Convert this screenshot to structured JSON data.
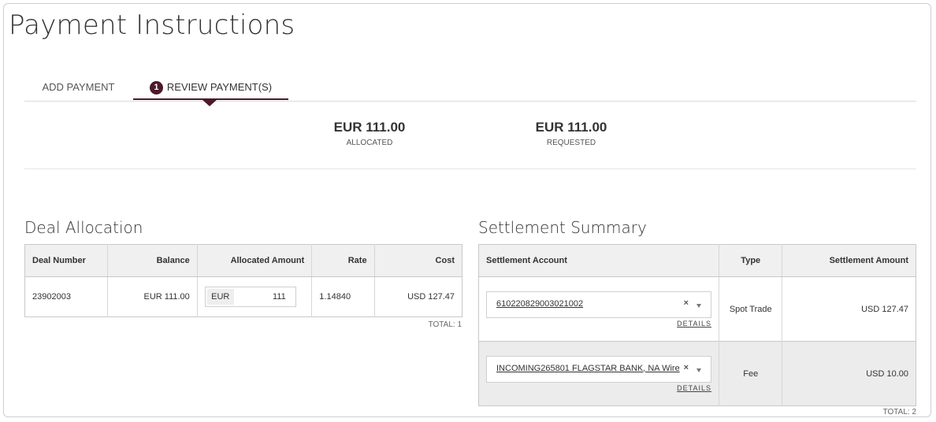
{
  "page": {
    "title": "Payment Instructions"
  },
  "tabs": [
    {
      "label": "ADD PAYMENT"
    },
    {
      "label": "REVIEW PAYMENT(S)",
      "badge": "1",
      "active": true
    }
  ],
  "summary": {
    "allocated": {
      "amount": "EUR 111.00",
      "label": "ALLOCATED"
    },
    "requested": {
      "amount": "EUR 111.00",
      "label": "REQUESTED"
    }
  },
  "deal_allocation": {
    "title": "Deal Allocation",
    "headers": [
      "Deal Number",
      "Balance",
      "Allocated Amount",
      "Rate",
      "Cost"
    ],
    "rows": [
      {
        "deal_number": "23902003",
        "balance": "EUR 111.00",
        "currency": "EUR",
        "allocated": "111",
        "rate": "1.14840",
        "cost": "USD 127.47"
      }
    ],
    "total": "TOTAL: 1"
  },
  "settlement_summary": {
    "title": "Settlement Summary",
    "headers": [
      "Settlement Account",
      "Type",
      "Settlement Amount"
    ],
    "rows": [
      {
        "account": "610220829003021002",
        "clear": "×",
        "details": "DETAILS",
        "type": "Spot Trade",
        "amount": "USD 127.47"
      },
      {
        "account": "INCOMING265801 FLAGSTAR BANK, NA Wire",
        "clear": "×",
        "details": "DETAILS",
        "type": "Fee",
        "amount": "USD 10.00"
      }
    ],
    "total": "TOTAL: 2"
  },
  "colors": {
    "accent": "#4a1a2a",
    "header_bg": "#f0f0f0",
    "border": "#c8c8c8"
  }
}
